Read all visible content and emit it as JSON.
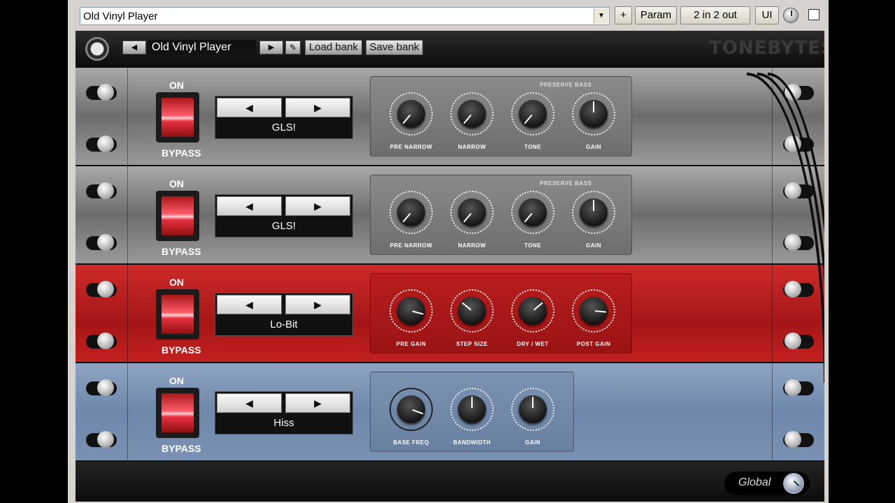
{
  "host": {
    "preset_select_value": "Old Vinyl Player",
    "add_button": "+",
    "param_button": "Param",
    "io_button": "2 in 2 out",
    "ui_button": "UI"
  },
  "toolbar": {
    "prev": "◀",
    "next": "▶",
    "bank_name": "Old Vinyl Player",
    "edit_icon": "pencil-icon",
    "load_bank": "Load bank",
    "save_bank": "Save bank",
    "brand": "TONEBYTES"
  },
  "racks": [
    {
      "theme": "gray",
      "on_label": "ON",
      "bypass_label": "BYPASS",
      "effect_name": "GLS!",
      "prev": "◀",
      "next": "▶",
      "panel_header": "PRESERVE BASS",
      "knobs": [
        {
          "label": "PRE NARROW"
        },
        {
          "label": "NARROW"
        },
        {
          "label": "TONE"
        },
        {
          "label": "GAIN"
        }
      ]
    },
    {
      "theme": "gray",
      "on_label": "ON",
      "bypass_label": "BYPASS",
      "effect_name": "GLS!",
      "prev": "◀",
      "next": "▶",
      "panel_header": "PRESERVE BASS",
      "knobs": [
        {
          "label": "PRE NARROW"
        },
        {
          "label": "NARROW"
        },
        {
          "label": "TONE"
        },
        {
          "label": "GAIN"
        }
      ]
    },
    {
      "theme": "red",
      "on_label": "ON",
      "bypass_label": "BYPASS",
      "effect_name": "Lo-Bit",
      "prev": "◀",
      "next": "▶",
      "panel_header": "",
      "knobs": [
        {
          "label": "PRE GAIN"
        },
        {
          "label": "STEP SIZE"
        },
        {
          "label": "DRY / WET"
        },
        {
          "label": "POST GAIN"
        }
      ]
    },
    {
      "theme": "blue",
      "on_label": "ON",
      "bypass_label": "BYPASS",
      "effect_name": "Hiss",
      "prev": "◀",
      "next": "▶",
      "panel_header": "",
      "knobs": [
        {
          "label": "BASE FREQ"
        },
        {
          "label": "BANDWIDTH"
        },
        {
          "label": "GAIN"
        }
      ]
    }
  ],
  "footer": {
    "global_label": "Global"
  }
}
